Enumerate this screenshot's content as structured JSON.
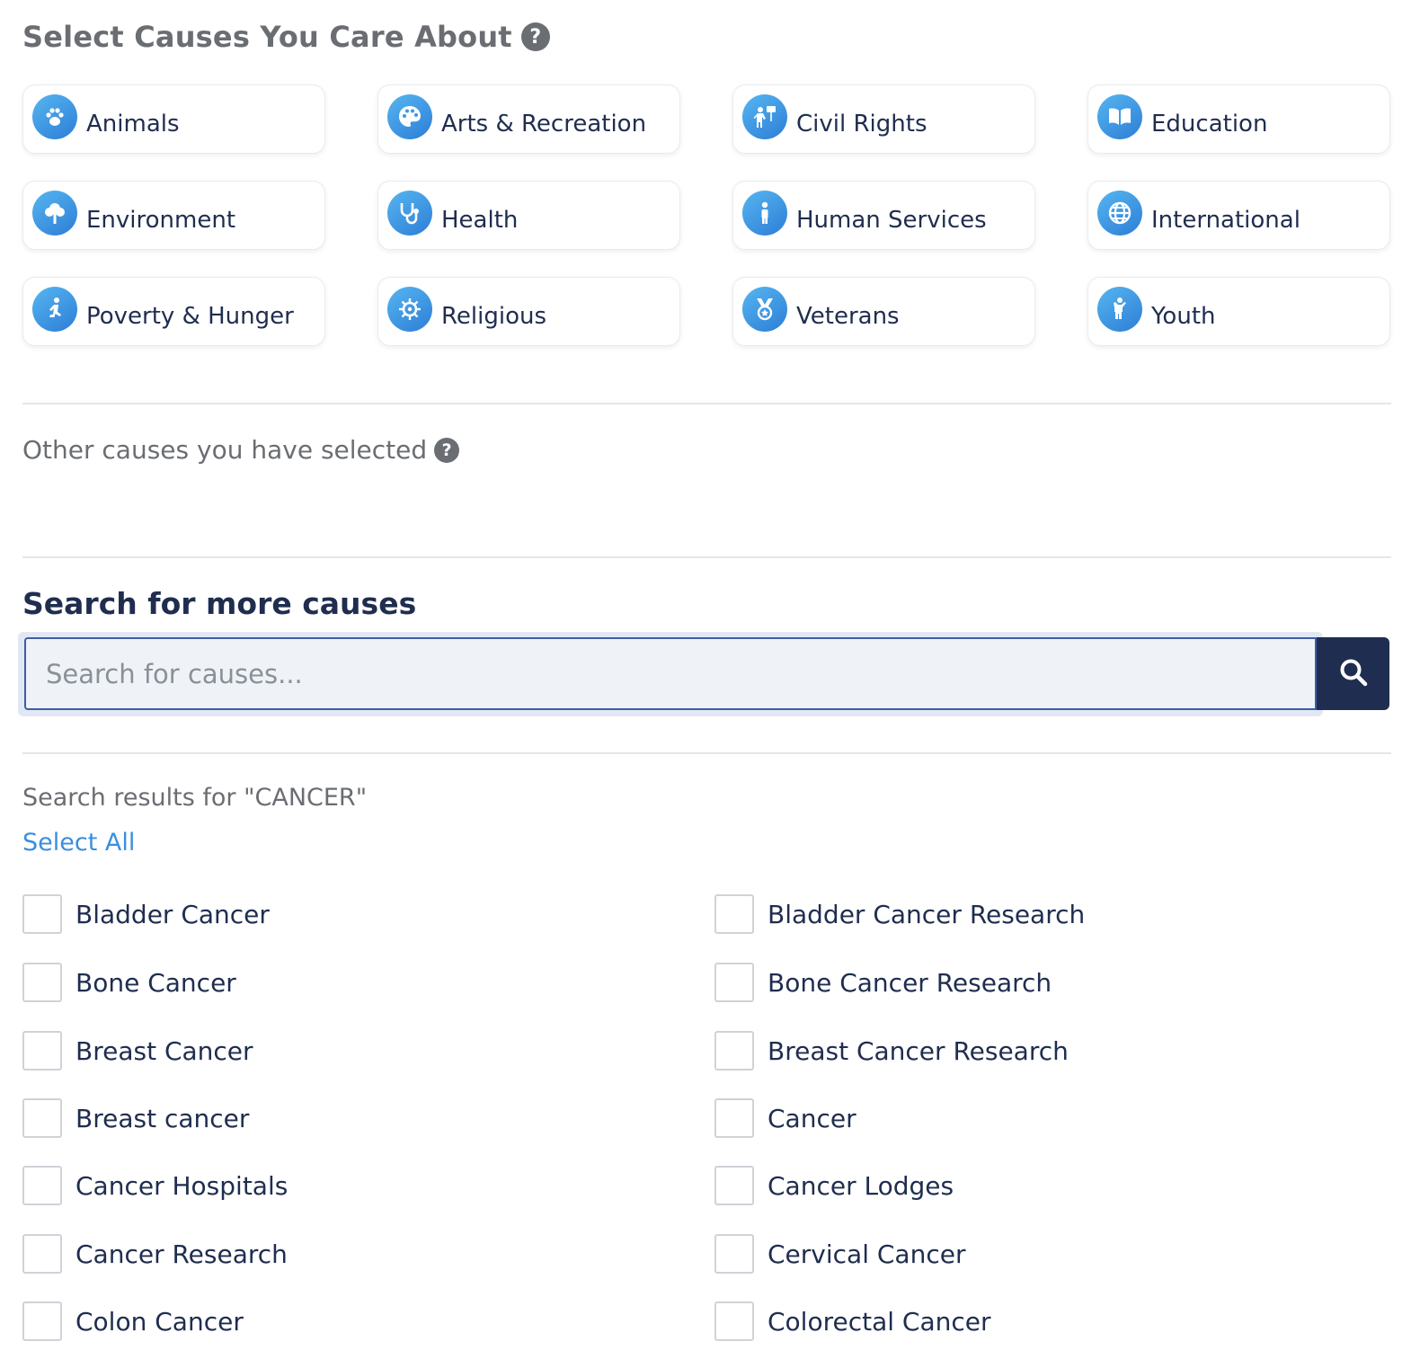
{
  "header": {
    "title": "Select Causes You Care About",
    "help": "?"
  },
  "causes": [
    {
      "label": "Animals",
      "icon": "paw-icon"
    },
    {
      "label": "Arts & Recreation",
      "icon": "palette-icon"
    },
    {
      "label": "Civil Rights",
      "icon": "protest-sign-icon"
    },
    {
      "label": "Education",
      "icon": "open-book-icon"
    },
    {
      "label": "Environment",
      "icon": "tree-icon"
    },
    {
      "label": "Health",
      "icon": "stethoscope-icon"
    },
    {
      "label": "Human Services",
      "icon": "person-icon"
    },
    {
      "label": "International",
      "icon": "globe-icon"
    },
    {
      "label": "Poverty & Hunger",
      "icon": "kneeling-person-icon"
    },
    {
      "label": "Religious",
      "icon": "dharma-wheel-icon"
    },
    {
      "label": "Veterans",
      "icon": "medal-icon"
    },
    {
      "label": "Youth",
      "icon": "child-icon"
    }
  ],
  "other": {
    "title": "Other causes you have selected",
    "help": "?"
  },
  "search": {
    "title": "Search for more causes",
    "placeholder": "Search for causes...",
    "value": ""
  },
  "results": {
    "title": "Search results for \"CANCER\"",
    "select_all": "Select All",
    "items": [
      {
        "label": "Bladder Cancer",
        "checked": false
      },
      {
        "label": "Bladder Cancer Research",
        "checked": false
      },
      {
        "label": "Bone Cancer",
        "checked": false
      },
      {
        "label": "Bone Cancer Research",
        "checked": false
      },
      {
        "label": "Breast Cancer",
        "checked": false
      },
      {
        "label": "Breast Cancer Research",
        "checked": false
      },
      {
        "label": "Breast cancer",
        "checked": false
      },
      {
        "label": "Cancer",
        "checked": false
      },
      {
        "label": "Cancer Hospitals",
        "checked": false
      },
      {
        "label": "Cancer Lodges",
        "checked": false
      },
      {
        "label": "Cancer Research",
        "checked": false
      },
      {
        "label": "Cervical Cancer",
        "checked": false
      },
      {
        "label": "Colon Cancer",
        "checked": false
      },
      {
        "label": "Colorectal Cancer",
        "checked": false
      }
    ]
  },
  "colors": {
    "accent": "#3a8ee0",
    "navy": "#1f2d50",
    "text": "#1f2d4f",
    "muted": "#6a6d72"
  }
}
